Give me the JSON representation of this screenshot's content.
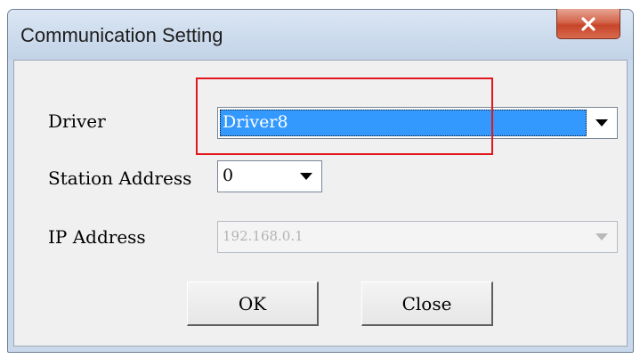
{
  "window": {
    "title": "Communication Setting"
  },
  "form": {
    "driver_label": "Driver",
    "driver_value": "Driver8",
    "station_label": "Station Address",
    "station_value": "0",
    "ip_label": "IP Address",
    "ip_value": "192.168.0.1"
  },
  "buttons": {
    "ok_label": "OK",
    "close_label": "Close"
  },
  "colors": {
    "selection": "#3399ff",
    "highlight_box": "#e2161d",
    "close_button": "#c7452a"
  },
  "icons": {
    "close": "close-x-icon",
    "dropdown": "dropdown-arrow-icon"
  }
}
